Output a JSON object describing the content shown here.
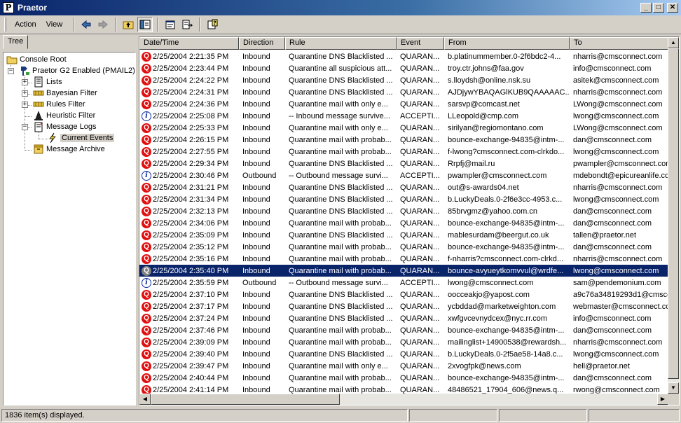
{
  "window": {
    "title": "Praetor",
    "app_icon_letter": "P"
  },
  "menu": {
    "action": "Action",
    "view": "View"
  },
  "toolbar_icons": [
    "back-arrow-icon",
    "forward-arrow-icon",
    "up-folder-icon",
    "show-hide-tree-icon",
    "properties-icon",
    "export-list-icon",
    "help-icon"
  ],
  "tabs": {
    "tree": "Tree"
  },
  "tree": {
    "root": "Console Root",
    "server": "Praetor G2 Enabled (PMAIL2)",
    "lists": "Lists",
    "bayesian": "Bayesian Filter",
    "rules": "Rules Filter",
    "heuristic": "Heuristic Filter",
    "logs": "Message Logs",
    "current": "Current Events",
    "archive": "Message Archive"
  },
  "columns": {
    "date": "Date/Time",
    "direction": "Direction",
    "rule": "Rule",
    "event": "Event",
    "from": "From",
    "to": "To"
  },
  "rows": [
    {
      "type": "q",
      "date": "2/25/2004 2:21:35 PM",
      "dir": "Inbound",
      "rule": "Quarantine DNS Blacklisted ...",
      "event": "QUARAN...",
      "from": "b.platinummember.0-2f6bdc2-4...",
      "to": "nharris@cmsconnect.com"
    },
    {
      "type": "q",
      "date": "2/25/2004 2:23:44 PM",
      "dir": "Inbound",
      "rule": "Quarantine all suspicious att...",
      "event": "QUARAN...",
      "from": "troy.ctr.johns@faa.gov",
      "to": "info@cmsconnect.com"
    },
    {
      "type": "q",
      "date": "2/25/2004 2:24:22 PM",
      "dir": "Inbound",
      "rule": "Quarantine DNS Blacklisted ...",
      "event": "QUARAN...",
      "from": "s.lloydsh@online.nsk.su",
      "to": "asitek@cmsconnect.com"
    },
    {
      "type": "q",
      "date": "2/25/2004 2:24:31 PM",
      "dir": "Inbound",
      "rule": "Quarantine DNS Blacklisted ...",
      "event": "QUARAN...",
      "from": "AJDjywYBAQAGlKUB9QAAAAAC...",
      "to": "nharris@cmsconnect.com"
    },
    {
      "type": "q",
      "date": "2/25/2004 2:24:36 PM",
      "dir": "Inbound",
      "rule": "Quarantine mail with only e...",
      "event": "QUARAN...",
      "from": "sarsvp@comcast.net",
      "to": "LWong@cmsconnect.com"
    },
    {
      "type": "i",
      "date": "2/25/2004 2:25:08 PM",
      "dir": "Inbound",
      "rule": "-- Inbound message survive...",
      "event": "ACCEPTI...",
      "from": "LLeopold@cmp.com",
      "to": "lwong@cmsconnect.com"
    },
    {
      "type": "q",
      "date": "2/25/2004 2:25:33 PM",
      "dir": "Inbound",
      "rule": "Quarantine mail with only e...",
      "event": "QUARAN...",
      "from": "sirilyan@regiomontano.com",
      "to": "LWong@cmsconnect.com"
    },
    {
      "type": "q",
      "date": "2/25/2004 2:26:15 PM",
      "dir": "Inbound",
      "rule": "Quarantine mail with probab...",
      "event": "QUARAN...",
      "from": "bounce-exchange-94835@intm-...",
      "to": "dan@cmsconnect.com"
    },
    {
      "type": "q",
      "date": "2/25/2004 2:27:55 PM",
      "dir": "Inbound",
      "rule": "Quarantine mail with probab...",
      "event": "QUARAN...",
      "from": "f-lwong?cmsconnect.com-clrkdo...",
      "to": "lwong@cmsconnect.com"
    },
    {
      "type": "q",
      "date": "2/25/2004 2:29:34 PM",
      "dir": "Inbound",
      "rule": "Quarantine DNS Blacklisted ...",
      "event": "QUARAN...",
      "from": "Rrpfj@mail.ru",
      "to": "pwampler@cmsconnect.com"
    },
    {
      "type": "i",
      "date": "2/25/2004 2:30:46 PM",
      "dir": "Outbound",
      "rule": "-- Outbound message survi...",
      "event": "ACCEPTI...",
      "from": "pwampler@cmsconnect.com",
      "to": "mdebondt@epicureanlife.co"
    },
    {
      "type": "q",
      "date": "2/25/2004 2:31:21 PM",
      "dir": "Inbound",
      "rule": "Quarantine DNS Blacklisted ...",
      "event": "QUARAN...",
      "from": "out@s-awards04.net",
      "to": "nharris@cmsconnect.com"
    },
    {
      "type": "q",
      "date": "2/25/2004 2:31:34 PM",
      "dir": "Inbound",
      "rule": "Quarantine DNS Blacklisted ...",
      "event": "QUARAN...",
      "from": "b.LuckyDeals.0-2f6e3cc-4953.c...",
      "to": "lwong@cmsconnect.com"
    },
    {
      "type": "q",
      "date": "2/25/2004 2:32:13 PM",
      "dir": "Inbound",
      "rule": "Quarantine DNS Blacklisted ...",
      "event": "QUARAN...",
      "from": "85brvgmz@yahoo.com.cn",
      "to": "dan@cmsconnect.com"
    },
    {
      "type": "q",
      "date": "2/25/2004 2:34:06 PM",
      "dir": "Inbound",
      "rule": "Quarantine mail with probab...",
      "event": "QUARAN...",
      "from": "bounce-exchange-94835@intm-...",
      "to": "dan@cmsconnect.com"
    },
    {
      "type": "q",
      "date": "2/25/2004 2:35:09 PM",
      "dir": "Inbound",
      "rule": "Quarantine DNS Blacklisted ...",
      "event": "QUARAN...",
      "from": "mablesurdam@beergut.co.uk",
      "to": "tallen@praetor.net"
    },
    {
      "type": "q",
      "date": "2/25/2004 2:35:12 PM",
      "dir": "Inbound",
      "rule": "Quarantine mail with probab...",
      "event": "QUARAN...",
      "from": "bounce-exchange-94835@intm-...",
      "to": "dan@cmsconnect.com"
    },
    {
      "type": "q",
      "date": "2/25/2004 2:35:16 PM",
      "dir": "Inbound",
      "rule": "Quarantine mail with probab...",
      "event": "QUARAN...",
      "from": "f-nharris?cmsconnect.com-clrkd...",
      "to": "nharris@cmsconnect.com"
    },
    {
      "type": "q",
      "selected": true,
      "date": "2/25/2004 2:35:40 PM",
      "dir": "Inbound",
      "rule": "Quarantine mail with probab...",
      "event": "QUARAN...",
      "from": "bounce-avyueytkomvvul@wrdfe...",
      "to": "lwong@cmsconnect.com"
    },
    {
      "type": "i",
      "date": "2/25/2004 2:35:59 PM",
      "dir": "Outbound",
      "rule": "-- Outbound message survi...",
      "event": "ACCEPTI...",
      "from": "lwong@cmsconnect.com",
      "to": "sam@pendemonium.com"
    },
    {
      "type": "q",
      "date": "2/25/2004 2:37:10 PM",
      "dir": "Inbound",
      "rule": "Quarantine DNS Blacklisted ...",
      "event": "QUARAN...",
      "from": "oocceakjo@yapost.com",
      "to": "a9c76a34819293d1@cmscc"
    },
    {
      "type": "q",
      "date": "2/25/2004 2:37:17 PM",
      "dir": "Inbound",
      "rule": "Quarantine DNS Blacklisted ...",
      "event": "QUARAN...",
      "from": "ycbddad@marketweighton.com",
      "to": "webmaster@cmsconnect.com"
    },
    {
      "type": "q",
      "date": "2/25/2004 2:37:24 PM",
      "dir": "Inbound",
      "rule": "Quarantine DNS Blacklisted ...",
      "event": "QUARAN...",
      "from": "xwfgvcevnydcex@nyc.rr.com",
      "to": "info@cmsconnect.com"
    },
    {
      "type": "q",
      "date": "2/25/2004 2:37:46 PM",
      "dir": "Inbound",
      "rule": "Quarantine mail with probab...",
      "event": "QUARAN...",
      "from": "bounce-exchange-94835@intm-...",
      "to": "dan@cmsconnect.com"
    },
    {
      "type": "q",
      "date": "2/25/2004 2:39:09 PM",
      "dir": "Inbound",
      "rule": "Quarantine mail with probab...",
      "event": "QUARAN...",
      "from": "mailinglist+14900538@rewardsh...",
      "to": "nharris@cmsconnect.com"
    },
    {
      "type": "q",
      "date": "2/25/2004 2:39:40 PM",
      "dir": "Inbound",
      "rule": "Quarantine DNS Blacklisted ...",
      "event": "QUARAN...",
      "from": "b.LuckyDeals.0-2f5ae58-14a8.c...",
      "to": "lwong@cmsconnect.com"
    },
    {
      "type": "q",
      "date": "2/25/2004 2:39:47 PM",
      "dir": "Inbound",
      "rule": "Quarantine mail with only e...",
      "event": "QUARAN...",
      "from": "2xvogfpk@news.com",
      "to": "hell@praetor.net"
    },
    {
      "type": "q",
      "date": "2/25/2004 2:40:44 PM",
      "dir": "Inbound",
      "rule": "Quarantine mail with probab...",
      "event": "QUARAN...",
      "from": "bounce-exchange-94835@intm-...",
      "to": "dan@cmsconnect.com"
    },
    {
      "type": "q",
      "date": "2/25/2004 2:41:14 PM",
      "dir": "Inbound",
      "rule": "Quarantine mail with probab...",
      "event": "QUARAN...",
      "from": "48486521_17904_606@news.q...",
      "to": "rwong@cmsconnect.com"
    }
  ],
  "status": {
    "text": "1836 item(s) displayed."
  }
}
